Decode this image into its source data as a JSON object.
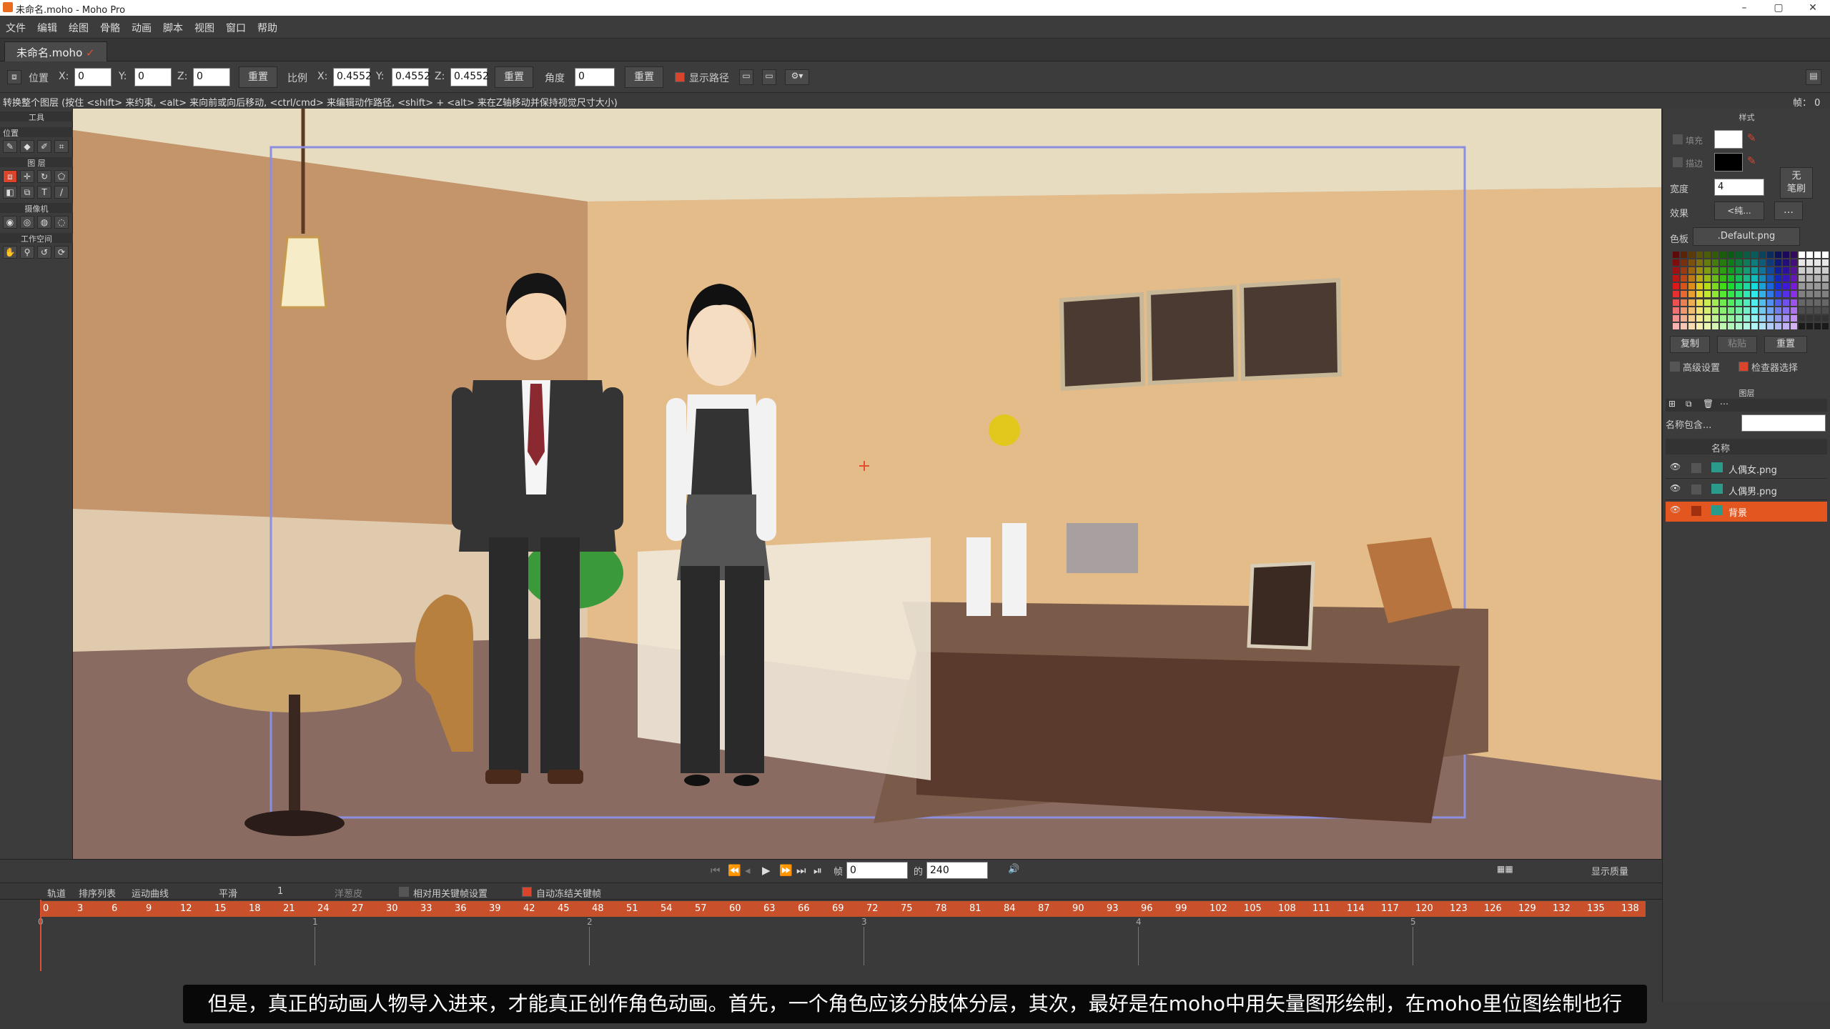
{
  "window": {
    "title": "未命名.moho - Moho Pro",
    "minimize": "–",
    "maximize": "▢",
    "close": "✕"
  },
  "menu": [
    "文件",
    "编辑",
    "绘图",
    "骨骼",
    "动画",
    "脚本",
    "视图",
    "窗口",
    "帮助"
  ],
  "doc_tab": {
    "name": "未命名.moho",
    "modified": "✓"
  },
  "tool_options": {
    "position_label": "位置",
    "x_label": "X:",
    "x_value": "0",
    "y_label": "Y:",
    "y_value": "0",
    "z_label": "Z:",
    "z_value": "0",
    "reset1": "重置",
    "scale_label": "比例",
    "sx_label": "X:",
    "sx_value": "0.4552",
    "sy_label": "Y:",
    "sy_value": "0.4552",
    "sz_label": "Z:",
    "sz_value": "0.4552",
    "reset2": "重置",
    "angle_label": "角度",
    "angle_value": "0",
    "reset3": "重置",
    "show_path_label": "显示路径"
  },
  "hint": "转换整个图层 (按住 <shift> 来约束, <alt> 来向前或向后移动, <ctrl/cmd> 来编辑动作路径, <shift> + <alt> 来在Z轴移动并保持视觉尺寸大小)",
  "frame_indicator": "帧： 0",
  "tools": {
    "title": "工具",
    "position": "位置",
    "layers": "图 层",
    "camera": "摄像机",
    "workspace": "工作空间"
  },
  "style": {
    "title": "样式",
    "fill_label": "填充",
    "stroke_label": "描边",
    "width_label": "宽度",
    "width_value": "4",
    "no_brush": "无\n笔刷",
    "effect_label": "效果",
    "effect_value": "<纯...",
    "palette_label": "色板",
    "palette_value": ".Default.png",
    "copy": "复制",
    "paste": "粘贴",
    "reset": "重置",
    "advanced": "高级设置",
    "checker": "检查器选择",
    "fill_color": "#ffffff",
    "stroke_color": "#000000"
  },
  "layers": {
    "title": "图层",
    "filter_label": "名称包含...",
    "name_col": "名称",
    "items": [
      {
        "name": "人偶女.png",
        "selected": false
      },
      {
        "name": "人偶男.png",
        "selected": false
      },
      {
        "name": "背景",
        "selected": true
      }
    ]
  },
  "playback": {
    "frame_label": "帧",
    "frame_value": "0",
    "of_label": "的",
    "total_value": "240",
    "quality": "显示质量"
  },
  "timeline": {
    "tabs": [
      "轨道",
      "排序列表",
      "运动曲线"
    ],
    "interp": "平滑",
    "interp_num": "1",
    "onion": "洋葱皮",
    "relative_keys": "相对用关键帧设置",
    "auto_freeze": "自动冻结关键帧",
    "ruler": [
      "0",
      "3",
      "6",
      "9",
      "12",
      "15",
      "18",
      "21",
      "24",
      "27",
      "30",
      "33",
      "36",
      "39",
      "42",
      "45",
      "48",
      "51",
      "54",
      "57",
      "60",
      "63",
      "66",
      "69",
      "72",
      "75",
      "78",
      "81",
      "84",
      "87",
      "90",
      "93",
      "96",
      "99",
      "102",
      "105",
      "108",
      "111",
      "114",
      "117",
      "120",
      "123",
      "126",
      "129",
      "132",
      "135",
      "138"
    ],
    "seconds": [
      "0",
      "1",
      "2",
      "3",
      "4",
      "5"
    ]
  },
  "subtitle": "但是，真正的动画人物导入进来，才能真正创作角色动画。首先，一个角色应该分肢体分层，其次，最好是在moho中用矢量图形绘制，在moho里位图绘制也行",
  "colors": {
    "accent": "#d9442a",
    "timeline_bar": "#c8512b",
    "layer_selected": "#e3561f"
  }
}
